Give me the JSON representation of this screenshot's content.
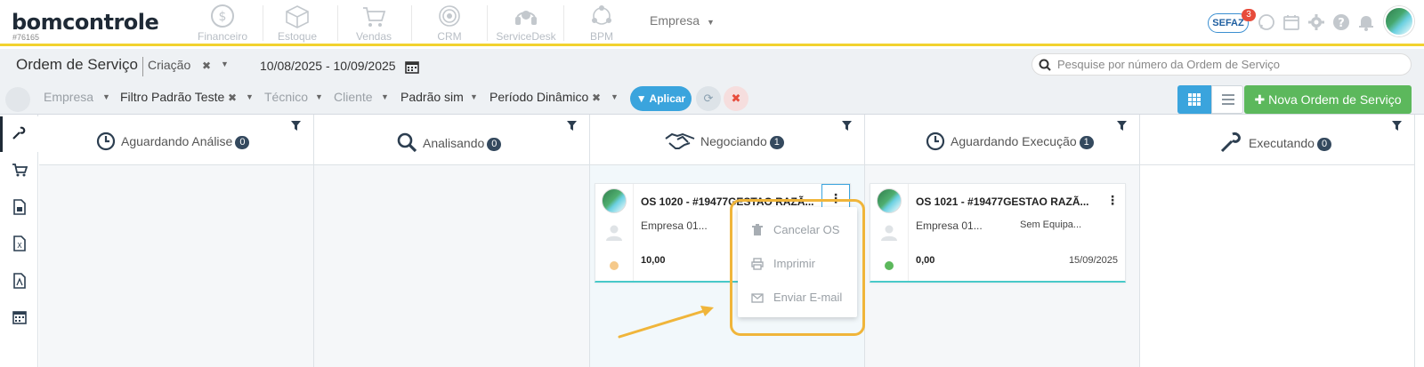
{
  "app": {
    "logo": "bomcontrole",
    "account_id": "#76165"
  },
  "modules": [
    {
      "label": "Financeiro",
      "icon": "dollar-coin-icon"
    },
    {
      "label": "Estoque",
      "icon": "box-icon"
    },
    {
      "label": "Vendas",
      "icon": "cart-icon"
    },
    {
      "label": "CRM",
      "icon": "target-icon"
    },
    {
      "label": "ServiceDesk",
      "icon": "headset-icon"
    },
    {
      "label": "BPM",
      "icon": "network-icon"
    }
  ],
  "company_selector": {
    "label": "Empresa"
  },
  "top_right": {
    "sefaz_label": "SEFAZ",
    "sefaz_count": "3"
  },
  "header": {
    "title": "Ordem de Serviço",
    "mode": "Criação",
    "date_range": "10/08/2025 - 10/09/2025",
    "search_placeholder": "Pesquise por número da Ordem de Serviço"
  },
  "filters": {
    "empresa": "Empresa",
    "filtro": "Filtro Padrão Teste",
    "tecnico": "Técnico",
    "cliente": "Cliente",
    "padrao": "Padrão sim",
    "periodo": "Período Dinâmico",
    "aplicar_label": "Aplicar",
    "nova_label": "Nova Ordem de Serviço"
  },
  "columns": [
    {
      "title": "Aguardando Análise",
      "count": "0"
    },
    {
      "title": "Analisando",
      "count": "0"
    },
    {
      "title": "Negociando",
      "count": "1"
    },
    {
      "title": "Aguardando Execução",
      "count": "1"
    },
    {
      "title": "Executando",
      "count": "0"
    }
  ],
  "cards": [
    {
      "title": "OS 1020 - #19477GESTAO RAZÃ...",
      "empresa": "Empresa 01...",
      "equipment": "",
      "value": "10,00",
      "date": "",
      "status_color": "#f5c98a"
    },
    {
      "title": "OS 1021 - #19477GESTAO RAZÃ...",
      "empresa": "Empresa 01...",
      "equipment": "Sem Equipa...",
      "value": "0,00",
      "date": "15/09/2025",
      "status_color": "#5cb85c"
    }
  ],
  "card_menu": {
    "items": [
      {
        "label": "Cancelar OS",
        "icon": "trash-icon"
      },
      {
        "label": "Imprimir",
        "icon": "printer-icon"
      },
      {
        "label": "Enviar E-mail",
        "icon": "envelope-icon"
      }
    ]
  },
  "colors": {
    "accent": "#3aa4dd",
    "success": "#5cb85c",
    "highlight": "#f0b53a",
    "topbar_border": "#f2d22e"
  }
}
